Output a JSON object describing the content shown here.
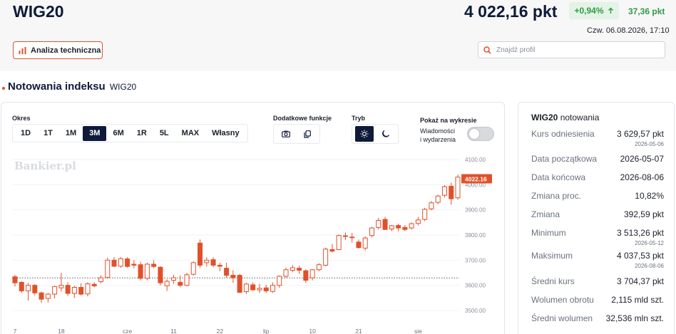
{
  "header": {
    "ticker": "WIG20",
    "price": "4 022,16 pkt",
    "change_pct": "+0,94%",
    "change_abs": "37,36 pkt",
    "datetime": "Czw. 06.08.2026, 17:10",
    "tech_analysis_label": "Analiza techniczna",
    "search_placeholder": "Znajdź profil"
  },
  "section": {
    "title": "Notowania indeksu",
    "subtitle": "WIG20"
  },
  "controls": {
    "period_label": "Okres",
    "periods": [
      "1D",
      "1T",
      "1M",
      "3M",
      "6M",
      "1R",
      "5L",
      "MAX",
      "Własny"
    ],
    "active_period": "3M",
    "extra_label": "Dodatkowe funkcje",
    "mode_label": "Tryb",
    "show_label": "Pokaż na wykresie",
    "news_label_line1": "Wiadomości",
    "news_label_line2": "i wydarzenia",
    "news_toggle_on": false
  },
  "chart_data": {
    "type": "candlestick",
    "watermark": "Bankier.pl",
    "last_price_label": "4022.16",
    "previous_close_line": 3629.57,
    "y_ticks": [
      "4100.00",
      "4000.00",
      "3900.00",
      "3800.00",
      "3700.00",
      "3600.00",
      "3500.00"
    ],
    "ylim": [
      3500,
      4100
    ],
    "x_ticks": [
      {
        "label": "7",
        "index": 0
      },
      {
        "label": "18",
        "index": 7
      },
      {
        "label": "cze",
        "index": 17
      },
      {
        "label": "11",
        "index": 24
      },
      {
        "label": "22",
        "index": 31
      },
      {
        "label": "lip",
        "index": 38
      },
      {
        "label": "10",
        "index": 45
      },
      {
        "label": "21",
        "index": 52
      },
      {
        "label": "sie",
        "index": 61
      }
    ],
    "candles": [
      [
        3634,
        3642,
        3595,
        3610
      ],
      [
        3612,
        3616,
        3570,
        3578
      ],
      [
        3578,
        3610,
        3540,
        3600
      ],
      [
        3600,
        3605,
        3560,
        3570
      ],
      [
        3570,
        3575,
        3530,
        3545
      ],
      [
        3548,
        3570,
        3532,
        3565
      ],
      [
        3565,
        3598,
        3548,
        3595
      ],
      [
        3590,
        3650,
        3575,
        3600
      ],
      [
        3600,
        3612,
        3558,
        3568
      ],
      [
        3568,
        3598,
        3550,
        3592
      ],
      [
        3592,
        3608,
        3560,
        3565
      ],
      [
        3566,
        3612,
        3556,
        3606
      ],
      [
        3604,
        3612,
        3592,
        3598
      ],
      [
        3615,
        3640,
        3608,
        3630
      ],
      [
        3632,
        3710,
        3626,
        3700
      ],
      [
        3700,
        3712,
        3672,
        3676
      ],
      [
        3676,
        3712,
        3670,
        3706
      ],
      [
        3705,
        3712,
        3670,
        3675
      ],
      [
        3684,
        3700,
        3668,
        3680
      ],
      [
        3682,
        3694,
        3620,
        3628
      ],
      [
        3628,
        3690,
        3620,
        3684
      ],
      [
        3684,
        3700,
        3668,
        3675
      ],
      [
        3672,
        3676,
        3600,
        3610
      ],
      [
        3598,
        3624,
        3578,
        3616
      ],
      [
        3620,
        3642,
        3606,
        3630
      ],
      [
        3612,
        3640,
        3592,
        3600
      ],
      [
        3600,
        3650,
        3596,
        3642
      ],
      [
        3644,
        3696,
        3638,
        3690
      ],
      [
        3768,
        3782,
        3670,
        3680
      ],
      [
        3690,
        3712,
        3674,
        3700
      ],
      [
        3702,
        3712,
        3672,
        3680
      ],
      [
        3680,
        3690,
        3656,
        3676
      ],
      [
        3668,
        3690,
        3630,
        3640
      ],
      [
        3640,
        3660,
        3610,
        3630
      ],
      [
        3640,
        3645,
        3570,
        3572
      ],
      [
        3575,
        3610,
        3565,
        3605
      ],
      [
        3602,
        3612,
        3578,
        3582
      ],
      [
        3582,
        3606,
        3570,
        3588
      ],
      [
        3590,
        3602,
        3570,
        3578
      ],
      [
        3576,
        3612,
        3570,
        3600
      ],
      [
        3600,
        3640,
        3590,
        3636
      ],
      [
        3636,
        3670,
        3630,
        3662
      ],
      [
        3660,
        3680,
        3652,
        3670
      ],
      [
        3668,
        3678,
        3646,
        3660
      ],
      [
        3658,
        3664,
        3610,
        3620
      ],
      [
        3630,
        3665,
        3620,
        3662
      ],
      [
        3662,
        3688,
        3656,
        3682
      ],
      [
        3680,
        3750,
        3676,
        3744
      ],
      [
        3742,
        3764,
        3730,
        3736
      ],
      [
        3742,
        3802,
        3740,
        3798
      ],
      [
        3797,
        3810,
        3780,
        3795
      ],
      [
        3792,
        3808,
        3770,
        3790
      ],
      [
        3772,
        3782,
        3746,
        3750
      ],
      [
        3748,
        3795,
        3738,
        3788
      ],
      [
        3798,
        3832,
        3790,
        3828
      ],
      [
        3830,
        3868,
        3822,
        3858
      ],
      [
        3862,
        3872,
        3820,
        3822
      ],
      [
        3824,
        3840,
        3815,
        3837
      ],
      [
        3838,
        3845,
        3815,
        3828
      ],
      [
        3830,
        3840,
        3815,
        3822
      ],
      [
        3828,
        3850,
        3822,
        3845
      ],
      [
        3846,
        3872,
        3838,
        3860
      ],
      [
        3862,
        3908,
        3855,
        3902
      ],
      [
        3904,
        3935,
        3898,
        3928
      ],
      [
        3930,
        3960,
        3922,
        3955
      ],
      [
        3958,
        3998,
        3950,
        3992
      ],
      [
        3994,
        4008,
        3920,
        3944
      ],
      [
        3948,
        4040,
        3940,
        4030
      ]
    ]
  },
  "stats": {
    "title": "WIG20",
    "title_suffix": "notowania",
    "rows": [
      {
        "label": "Kurs odniesienia",
        "value": "3 629,57 pkt",
        "date": "2026-05-06"
      },
      {
        "label": "Data początkowa",
        "value": "2026-05-07"
      },
      {
        "label": "Data końcowa",
        "value": "2026-08-06"
      },
      {
        "label": "Zmiana proc.",
        "value": "10,82%"
      },
      {
        "label": "Zmiana",
        "value": "392,59 pkt"
      },
      {
        "label": "Minimum",
        "value": "3 513,26 pkt",
        "date": "2026-05-12"
      },
      {
        "label": "Maksimum",
        "value": "4 037,53 pkt",
        "date": "2026-08-06"
      },
      {
        "label": "Średni kurs",
        "value": "3 704,37 pkt"
      },
      {
        "label": "Wolumen obrotu",
        "value": "2,115 mld szt."
      },
      {
        "label": "Średni wolumen",
        "value": "32,536 mln szt."
      }
    ]
  },
  "colors": {
    "accent": "#e0512b",
    "navy": "#0f1a3a",
    "green": "#2f9a45"
  },
  "icons": [
    "chart-bars-icon",
    "search-icon",
    "arrow-up-icon",
    "camera-icon",
    "copy-icon",
    "sun-icon",
    "moon-icon"
  ]
}
